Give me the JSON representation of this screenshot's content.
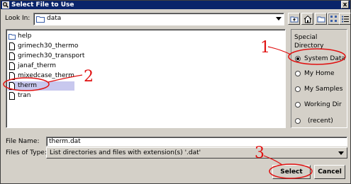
{
  "window": {
    "title": "Select File to Use",
    "close_glyph": "x"
  },
  "lookin": {
    "label": "Look In:",
    "value": "data"
  },
  "toolbar": {
    "icons": [
      "up-folder-icon",
      "home-icon",
      "new-folder-icon",
      "list-view-icon",
      "details-view-icon"
    ]
  },
  "files": [
    {
      "name": "help",
      "type": "folder"
    },
    {
      "name": "grimech30_thermo",
      "type": "file"
    },
    {
      "name": "grimech30_transport",
      "type": "file"
    },
    {
      "name": "janaf_therm",
      "type": "file"
    },
    {
      "name": "mixedcase_therm",
      "type": "file"
    },
    {
      "name": "therm",
      "type": "file",
      "selected": true
    },
    {
      "name": "tran",
      "type": "file"
    }
  ],
  "special": {
    "header_line1": "Special",
    "header_line2": "Directory",
    "options": [
      {
        "label": "System Data",
        "selected": true
      },
      {
        "label": "My Home",
        "selected": false
      },
      {
        "label": "My Samples",
        "selected": false
      },
      {
        "label": "Working Dir",
        "selected": false
      },
      {
        "label": "(recent)",
        "selected": false
      }
    ]
  },
  "filename": {
    "label": "File Name:",
    "value": "therm.dat"
  },
  "filetype": {
    "label": "Files of Type:",
    "value": "List directories and files with extension(s) '.dat'"
  },
  "buttons": {
    "select": "Select",
    "cancel": "Cancel"
  },
  "annotations": {
    "one": "1",
    "two": "2",
    "three": "3",
    "color": "#e01010"
  }
}
